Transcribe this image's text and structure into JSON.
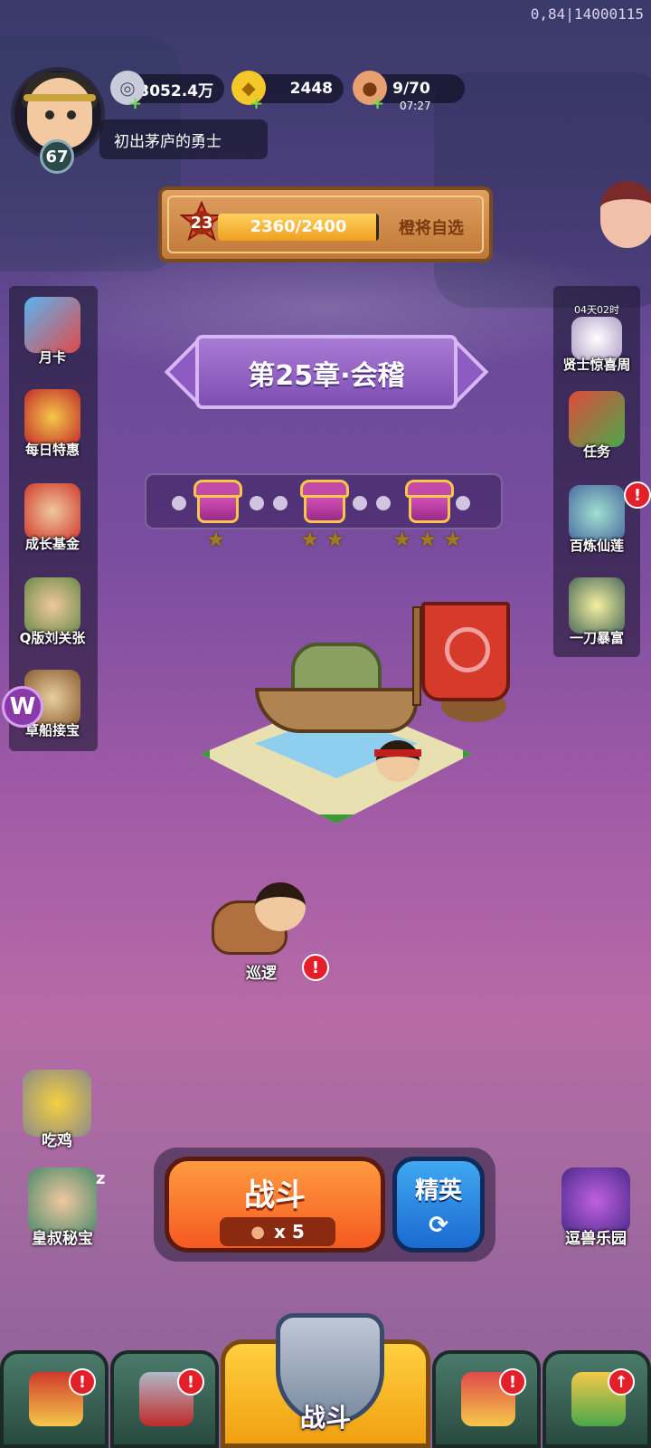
{
  "debug_info": "0,84|14000115",
  "player": {
    "level": "67",
    "title": "初出茅庐的勇士"
  },
  "resources": {
    "silver": "3052.4万",
    "gold": "2448",
    "stamina": "9/70",
    "stamina_timer": "07:27"
  },
  "level_banner": {
    "level": "23",
    "exp_text": "2360/2400",
    "exp_progress": 0.983,
    "link_label": "橙将自选"
  },
  "left_menu": {
    "monthly_card": "月卡",
    "daily_deal": "每日特惠",
    "growth_fund": "成长基金",
    "q_version": "Q版刘关张",
    "boat_treasure": "草船接宝"
  },
  "right_menu": {
    "sage_week_timer": "04天02时",
    "sage_week": "贤士惊喜周",
    "tasks": "任务",
    "refine": "百炼仙莲",
    "one_blade": "一刀暴富"
  },
  "chapter": {
    "title": "第25章·会稽",
    "chests": [
      {
        "stars": 1
      },
      {
        "stars": 2
      },
      {
        "stars": 3
      }
    ]
  },
  "patrol_label": "巡逻",
  "alert_mark": "!",
  "floaters": {
    "chicken": "吃鸡",
    "uncle_treasure": "皇叔秘宝",
    "sleep_mark": "z",
    "beast_park": "逗兽乐园"
  },
  "battle": {
    "label": "战斗",
    "cost": "x 5",
    "elite_label": "精英",
    "elite_icon": "refresh-icon"
  },
  "bottom_nav": {
    "center_label": "战斗"
  },
  "colors": {
    "accent_orange": "#f55a20",
    "accent_blue": "#1a6ad0",
    "alert_red": "#e3202a",
    "nav_active": "#f0a010"
  }
}
